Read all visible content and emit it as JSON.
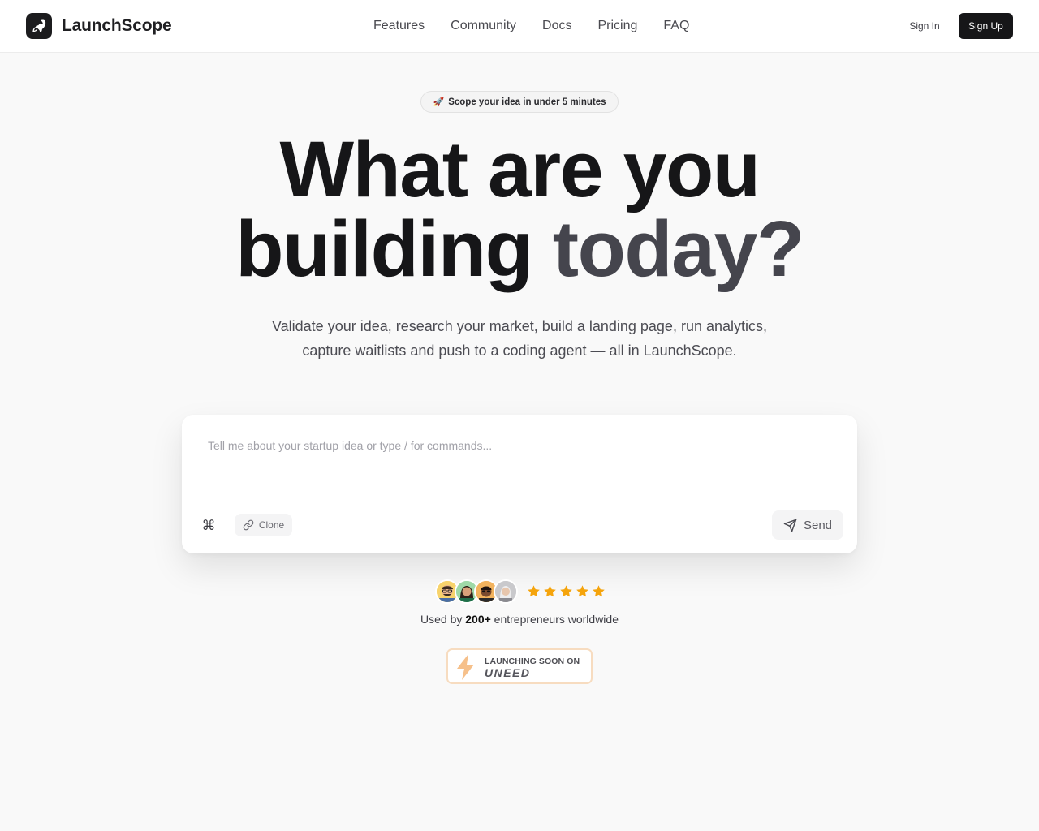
{
  "brand": {
    "name": "LaunchScope",
    "logo_icon": "rocket-icon"
  },
  "nav": {
    "links": [
      {
        "label": "Features"
      },
      {
        "label": "Community"
      },
      {
        "label": "Docs"
      },
      {
        "label": "Pricing"
      },
      {
        "label": "FAQ"
      }
    ],
    "sign_in": "Sign In",
    "sign_up": "Sign Up"
  },
  "hero": {
    "pill_emoji": "🚀",
    "pill_text": "Scope your idea in under 5 minutes",
    "headline_line1": "What are you",
    "headline_line2_a": "building ",
    "headline_line2_b": "today?",
    "subtitle_line1": "Validate your idea, research your market, build a landing page, run analytics,",
    "subtitle_line2": "capture waitlists and push to a coding agent — all in LaunchScope."
  },
  "prompt": {
    "placeholder": "Tell me about your startup idea or type / for commands...",
    "value": "",
    "command_symbol": "⌘",
    "clone_label": "Clone",
    "send_label": "Send"
  },
  "social_proof": {
    "rating_stars": 5,
    "used_by_prefix": "Used by ",
    "used_by_count": "200+",
    "used_by_suffix": " entrepreneurs worldwide"
  },
  "badge": {
    "top_text": "LAUNCHING SOON ON",
    "logo_text": "UNEED"
  },
  "colors": {
    "background": "#f9f9f9",
    "primary_dark": "#161618",
    "headline_dim": "#45454d",
    "star": "#f5a40c",
    "badge_border": "#f7dcc0",
    "badge_bolt": "#f6c08a"
  }
}
